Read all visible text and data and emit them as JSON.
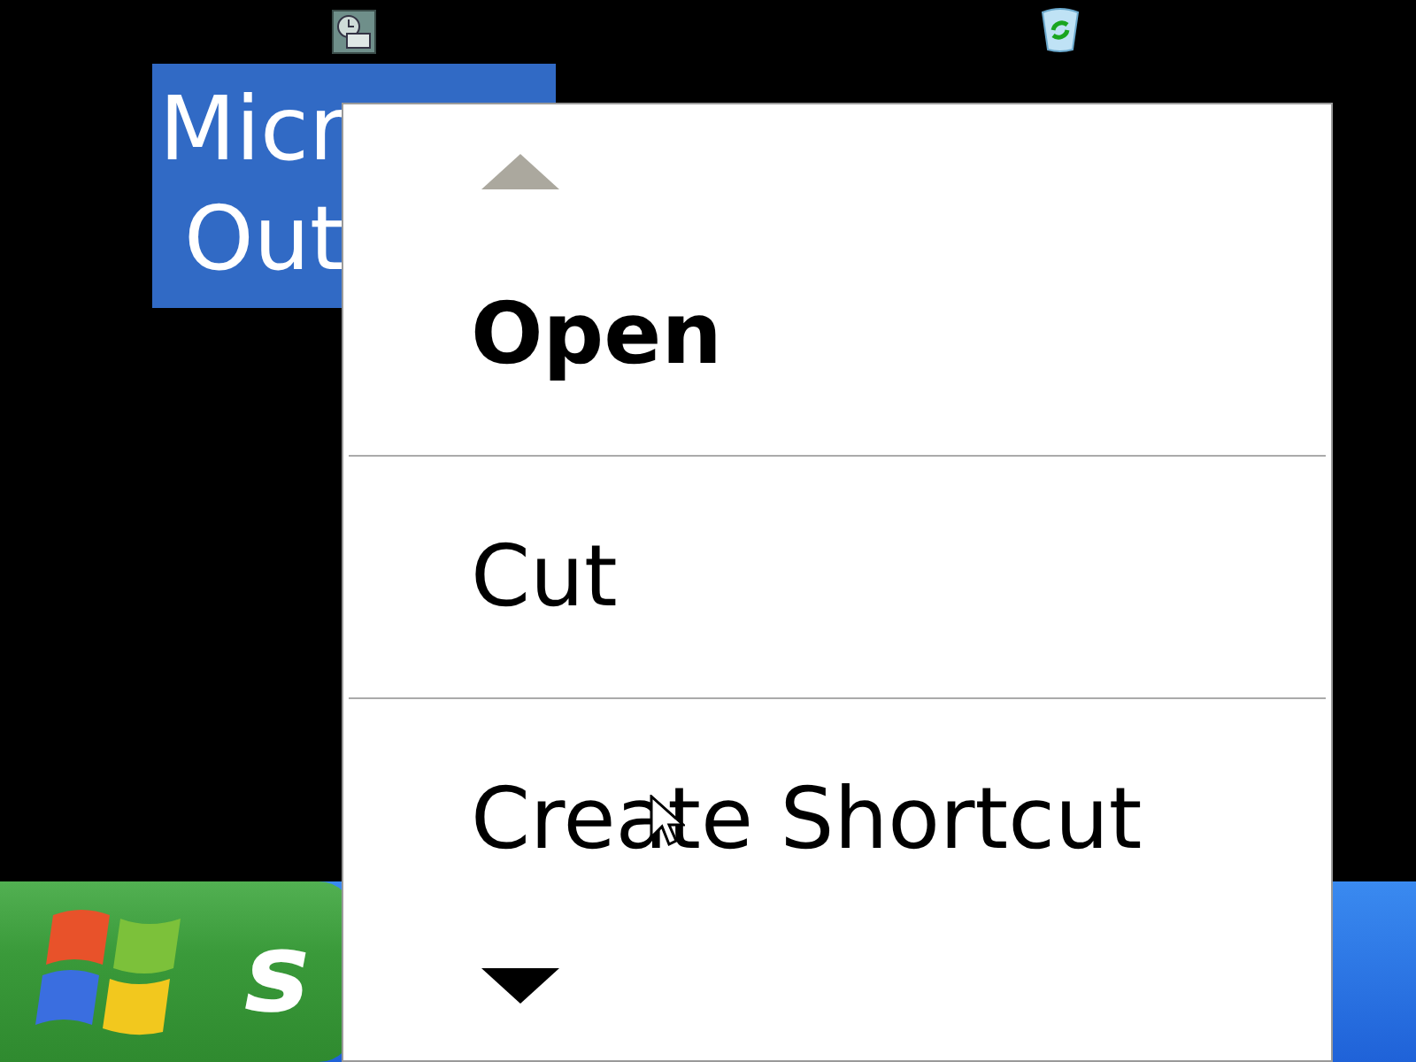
{
  "desktop": {
    "icons": [
      {
        "kind": "outlook",
        "label_lines": [
          "Micr",
          "Out"
        ],
        "selected": true
      },
      {
        "kind": "recycle"
      }
    ]
  },
  "context_menu": {
    "scroll_up": {
      "disabled": true
    },
    "scroll_down": {
      "disabled": false
    },
    "items": [
      {
        "label": "Open",
        "default": true
      },
      {
        "label": "Cut",
        "default": false
      },
      {
        "label": "Create Shortcut",
        "default": false
      }
    ]
  },
  "taskbar": {
    "start_label": "s"
  }
}
